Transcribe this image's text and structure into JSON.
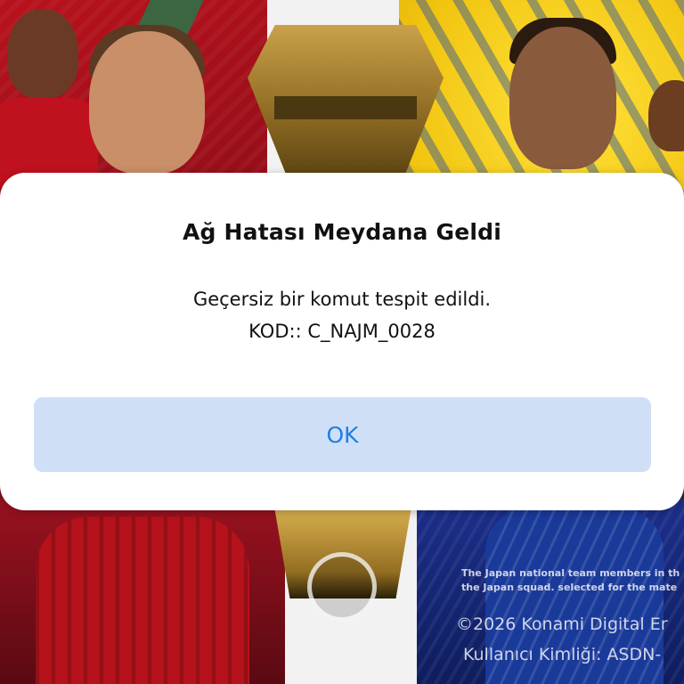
{
  "dialog": {
    "title": "Ağ Hatası Meydana Geldi",
    "message_line1": "Geçersiz bir komut tespit edildi.",
    "message_line2": "KOD:: C_NAJM_0028",
    "ok_label": "OK"
  },
  "background": {
    "japan_note_line1": "The Japan national team members in th",
    "japan_note_line2": "the Japan squad. selected for the mate",
    "copyright": "©2026 Konami Digital Er",
    "user_id": "Kullanıcı Kimliği: ASDN-"
  },
  "colors": {
    "dialog_bg": "#ffffff",
    "ok_button_bg": "#cfe0f6",
    "ok_button_text": "#1f7fe8",
    "title_text": "#111111"
  }
}
